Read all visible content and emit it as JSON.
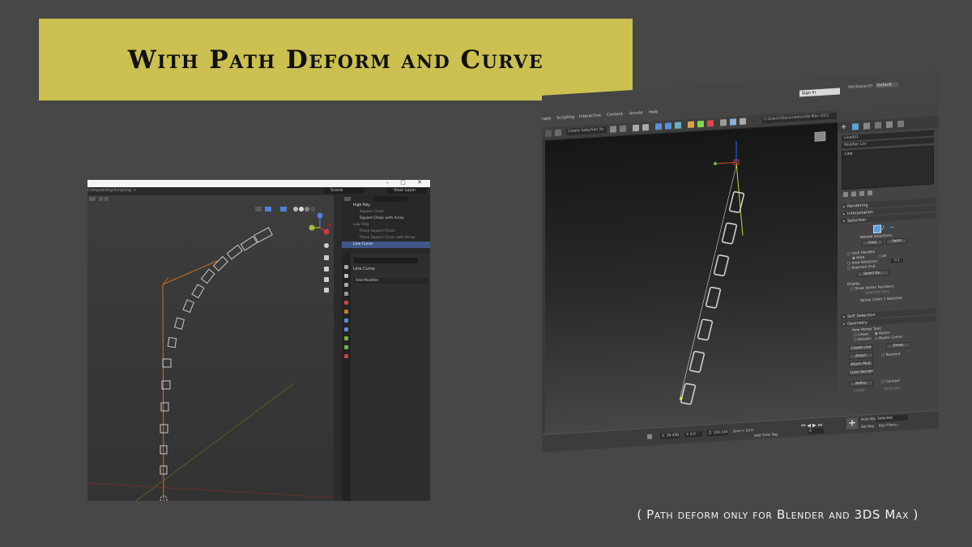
{
  "title": "With Path Deform and Curve",
  "caption": "( Path deform only for Blender and 3DS Max )",
  "colors": {
    "background": "#474747",
    "banner": "#cbc050",
    "blender_curve": "#d0721d",
    "blender_selected_row": "#41578a",
    "max_gizmo_z": "#2d5bd6",
    "max_gizmo_x": "#d43a2a",
    "max_gizmo_y": "#cfd63a"
  },
  "blender": {
    "tabs": [
      "Compositing",
      "Scripting",
      "+"
    ],
    "scene": "Scene",
    "view_layer": "View Layer",
    "outliner": [
      {
        "label": "High Poly",
        "selected": false
      },
      {
        "label": "Square Chain",
        "selected": false
      },
      {
        "label": "Square Chain with Array",
        "selected": false
      },
      {
        "label": "Low Poly",
        "selected": false
      },
      {
        "label": "Plane Square Chain",
        "selected": false
      },
      {
        "label": "Plane Square Chain with Array",
        "selected": false
      },
      {
        "label": "Line Curve",
        "selected": true
      }
    ],
    "properties": {
      "object_name": "Line Curve",
      "add_modifier": "Add Modifier"
    },
    "window_controls": "– ▢ ✕"
  },
  "max": {
    "sign_in": "Sign In",
    "workspaces_label": "Workspaces:",
    "workspace_value": "Default",
    "menus": [
      "rape",
      "Scripting",
      "Interactive",
      "Content",
      "Arnold",
      "Help"
    ],
    "selection_set": "Create Selection Se",
    "file_path": "C:\\Users\\\\Documents\\3ds Max 2021",
    "object_name": "Line001",
    "modifier_list": "Modifier List",
    "stack_item": "Line",
    "rollouts": [
      "Rendering",
      "Interpolation",
      "Selection",
      "Soft Selection",
      "Geometry"
    ],
    "selection": {
      "named_selections": "Named Selections:",
      "copy": "Copy",
      "paste": "Paste",
      "lock_handles": "Lock Handles",
      "alike": "Alike",
      "all": "All",
      "area_selection": "Area Selection:",
      "area_value": "0.1",
      "segment_end": "Segment End",
      "select_by": "Select By...",
      "display": "Display",
      "show_vertex_numbers": "Show Vertex Numbers",
      "selected_only": "Selected Only",
      "status": "Spline 1/Vert 1 Selected"
    },
    "geometry": {
      "new_vertex_type": "New Vertex Type",
      "linear": "Linear",
      "bezier": "Bezier",
      "smooth": "Smooth",
      "bezier_corner": "Bezier Corner",
      "create_line": "Create Line",
      "break": "Break",
      "attach": "Attach",
      "reorient": "Reorient",
      "attach_mult": "Attach Mult.",
      "cross_section": "Cross Section",
      "refine": "Refine",
      "connect": "Connect",
      "linear2": "Linear",
      "bind_first": "Bind first"
    },
    "status": {
      "x_value": "36.438",
      "y_value": "0.0",
      "z_value": "150.143",
      "grid": "Grid = 10.0",
      "add_time_tag": "Add Time Tag",
      "frame": "0",
      "set_key": "Set Key",
      "selected": "Selected",
      "auto_key": "Auto Key",
      "key_filters": "Key Filters..."
    }
  }
}
